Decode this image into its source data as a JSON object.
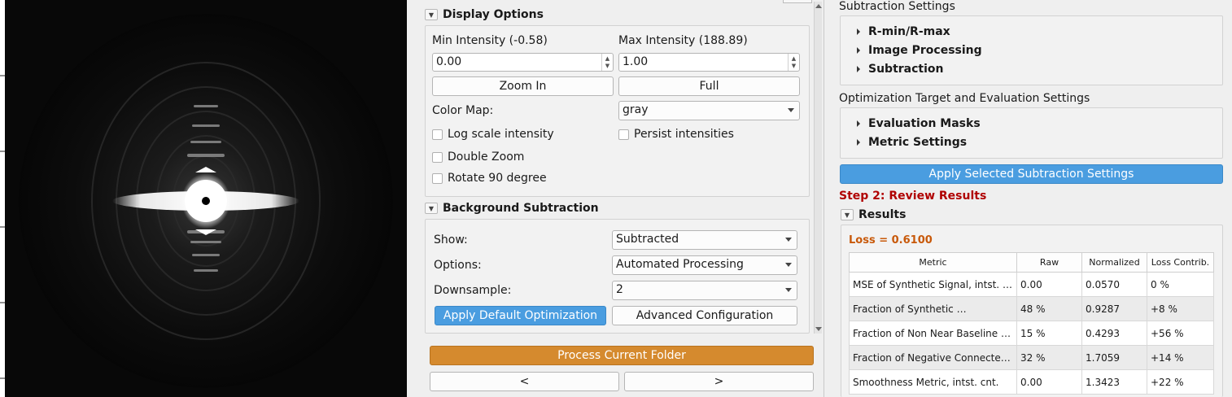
{
  "display_options": {
    "title": "Display Options",
    "min_intensity_label": "Min Intensity (-0.58)",
    "max_intensity_label": "Max Intensity (188.89)",
    "min_value": "0.00",
    "max_value": "1.00",
    "zoom_in_label": "Zoom In",
    "full_label": "Full",
    "color_map_label": "Color Map:",
    "color_map_value": "gray",
    "log_scale_label": "Log scale intensity",
    "persist_label": "Persist intensities",
    "double_zoom_label": "Double Zoom",
    "rotate_label": "Rotate 90 degree"
  },
  "background_subtraction": {
    "title": "Background Subtraction",
    "show_label": "Show:",
    "show_value": "Subtracted",
    "options_label": "Options:",
    "options_value": "Automated Processing",
    "downsample_label": "Downsample:",
    "downsample_value": "2",
    "apply_default_label": "Apply Default Optimization",
    "advanced_label": "Advanced Configuration"
  },
  "process_folder_label": "Process Current Folder",
  "nav": {
    "prev_label": "<",
    "next_label": ">"
  },
  "subtraction_settings": {
    "title": "Subtraction Settings",
    "items": [
      "R-min/R-max",
      "Image Processing",
      "Subtraction"
    ]
  },
  "optimization": {
    "title": "Optimization Target and Evaluation Settings",
    "items": [
      "Evaluation Masks",
      "Metric Settings"
    ]
  },
  "apply_selected_label": "Apply Selected Subtraction Settings",
  "step2_title": "Step 2: Review Results",
  "results": {
    "title": "Results",
    "loss_text": "Loss = 0.6100",
    "columns": [
      "Metric",
      "Raw",
      "Normalized",
      "Loss Contrib."
    ],
    "rows": [
      [
        "MSE of Synthetic Signal, intst. cnt.",
        "0.00",
        "0.0570",
        "0 %"
      ],
      [
        "Fraction of Synthetic …",
        "48 %",
        "0.9287",
        "+8 %"
      ],
      [
        "Fraction of Non Near Baseline Pixels",
        "15 %",
        "0.4293",
        "+56 %"
      ],
      [
        "Fraction of Negative Connected Pixels",
        "32 %",
        "1.7059",
        "+14 %"
      ],
      [
        "Smoothness Metric, intst. cnt.",
        "0.00",
        "1.3423",
        "+22 %"
      ]
    ]
  },
  "colors": {
    "accent_blue": "#4a9de0",
    "accent_orange": "#d58a2e",
    "step_red": "#b00000",
    "loss_orange": "#c8590a"
  }
}
